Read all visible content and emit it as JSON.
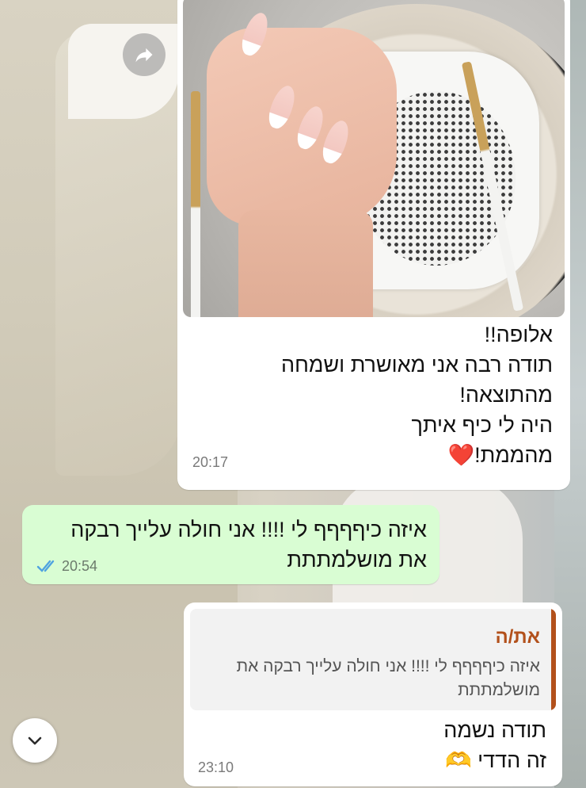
{
  "chat": {
    "messages": [
      {
        "direction": "incoming",
        "has_image": true,
        "lines": [
          "אלופה!!",
          "תודה רבה אני מאושרת ושמחה",
          "מהתוצאה!",
          "היה לי כיף איתך",
          "מהממת!"
        ],
        "emoji": "❤️",
        "time": "20:17"
      },
      {
        "direction": "outgoing",
        "lines": [
          "איזה כיףףףף לי !!!! אני חולה עלייך רבקה",
          "את מושלמתתת"
        ],
        "time": "20:54",
        "status": "read"
      },
      {
        "direction": "incoming",
        "quoted": {
          "author": "את/ה",
          "lines": [
            "איזה כיףףףף לי !!!! אני חולה עלייך רבקה את",
            "מושלמתתת"
          ]
        },
        "lines": [
          "תודה נשמה",
          "זה הדדי"
        ],
        "emoji": "🫶",
        "time": "23:10"
      }
    ]
  },
  "colors": {
    "outgoing_bubble": "#d9fdd3",
    "incoming_bubble": "#ffffff",
    "quote_accent": "#b2501b",
    "read_ticks": "#4fa3e0"
  },
  "icons": {
    "forward": "forward-arrow-icon",
    "scroll_down": "chevron-down-icon",
    "read_receipt": "double-check-icon"
  }
}
